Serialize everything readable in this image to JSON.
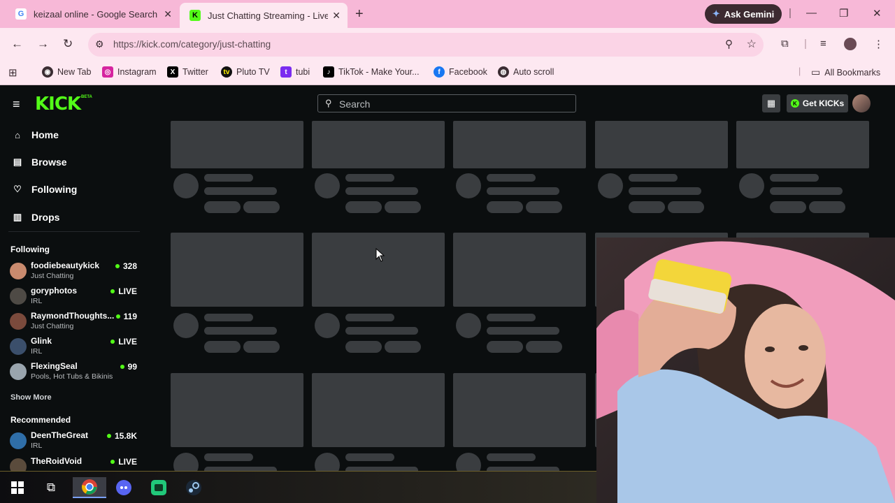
{
  "browser": {
    "tabs": [
      {
        "title": "keizaal online - Google Search",
        "favicon": "google-icon",
        "active": false
      },
      {
        "title": "Just Chatting Streaming - Live S",
        "favicon": "kick-icon",
        "active": true
      }
    ],
    "gemini_label": "Ask Gemini",
    "url": "https://kick.com/category/just-chatting",
    "bookmarks": [
      {
        "label": "New Tab",
        "icon": "chrome-icon"
      },
      {
        "label": "Instagram",
        "icon": "instagram-icon"
      },
      {
        "label": "Twitter",
        "icon": "x-icon"
      },
      {
        "label": "Pluto TV",
        "icon": "pluto-icon"
      },
      {
        "label": "tubi",
        "icon": "tubi-icon"
      },
      {
        "label": "TikTok - Make Your...",
        "icon": "tiktok-icon"
      },
      {
        "label": "Facebook",
        "icon": "facebook-icon"
      },
      {
        "label": "Auto scroll",
        "icon": "globe-icon"
      }
    ],
    "all_bookmarks": "All Bookmarks"
  },
  "kick": {
    "logo": "KICK",
    "logo_badge": "BETA",
    "search_placeholder": "Search",
    "get_kicks": "Get KICKs",
    "nav": [
      {
        "label": "Home",
        "icon": "home-icon"
      },
      {
        "label": "Browse",
        "icon": "browse-icon"
      },
      {
        "label": "Following",
        "icon": "heart-icon"
      },
      {
        "label": "Drops",
        "icon": "drops-icon"
      }
    ],
    "following_title": "Following",
    "following": [
      {
        "name": "foodiebeautykick",
        "category": "Just Chatting",
        "viewers": "328",
        "color": "#c98a6e"
      },
      {
        "name": "goryphotos",
        "category": "IRL",
        "viewers": "LIVE",
        "color": "#4e4a45"
      },
      {
        "name": "RaymondThoughts...",
        "category": "Just Chatting",
        "viewers": "119",
        "color": "#7a4a3c"
      },
      {
        "name": "Glink",
        "category": "IRL",
        "viewers": "LIVE",
        "color": "#3b4f6b"
      },
      {
        "name": "FlexingSeal",
        "category": "Pools, Hot Tubs & Bikinis",
        "viewers": "99",
        "color": "#9aa5ae"
      }
    ],
    "show_more": "Show More",
    "recommended_title": "Recommended",
    "recommended": [
      {
        "name": "DeenTheGreat",
        "category": "IRL",
        "viewers": "15.8K",
        "color": "#2f6ea8"
      },
      {
        "name": "TheRoidVoid",
        "category": "",
        "viewers": "LIVE",
        "color": "#5a4b3c"
      }
    ]
  },
  "taskbar": {
    "icons": [
      "windows-start-icon",
      "task-view-icon",
      "chrome-icon",
      "discord-icon",
      "app-icon",
      "steam-icon"
    ]
  }
}
